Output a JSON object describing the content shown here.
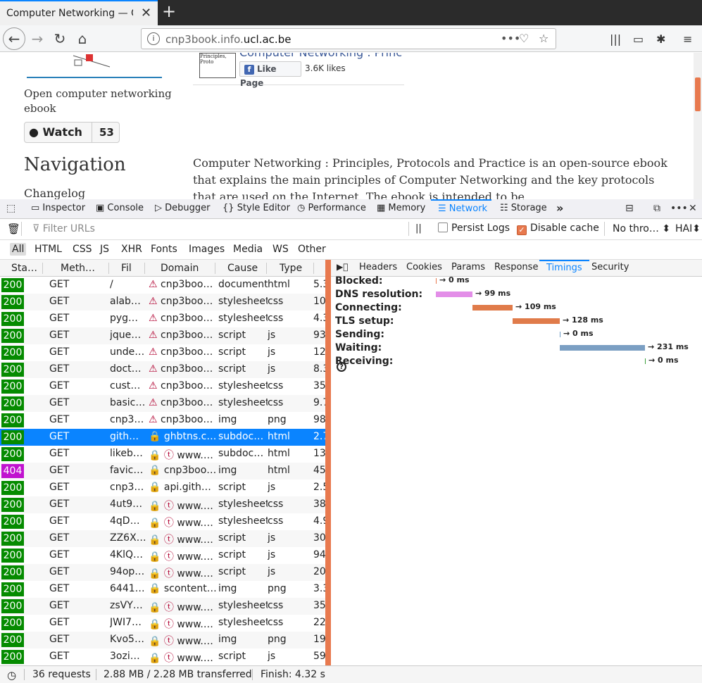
{
  "browser": {
    "tab_title": "Computer Networking — C",
    "tab_close": "✕",
    "new_tab": "+",
    "url_prefix": "cnp3book.info.",
    "url_domain": "ucl.ac.be",
    "url_info_icon": "i",
    "page_actions": "•••"
  },
  "page": {
    "tagline": "Open computer networking ebook",
    "watch_label": "Watch",
    "watch_count": "53",
    "nav_heading": "Navigation",
    "changelog": "Changelog",
    "fb_title": "Computer Networking : Princ",
    "fb_like": "Like Page",
    "fb_count": "3.6K likes",
    "fb_thumb_text": "Principles, Proto",
    "body_text": "Computer Networking : Principles, Protocols and Practice is an open-source ebook that explains the main principles of Computer Networking and the key protocols that are used on the Internet. The ebook is intended to be"
  },
  "devtools": {
    "tabs": [
      "Inspector",
      "Console",
      "Debugger",
      "Style Editor",
      "Performance",
      "Memory",
      "Network",
      "Storage"
    ],
    "active_tab": "Network",
    "more": "»",
    "close": "✕",
    "filter_placeholder": "Filter URLs",
    "pause": "||",
    "persist_logs": "Persist Logs",
    "disable_cache": "Disable cache",
    "throttling": "No thro… ⬍",
    "har": "HAI⬍",
    "types": [
      "All",
      "HTML",
      "CSS",
      "JS",
      "XHR",
      "Fonts",
      "Images",
      "Media",
      "WS",
      "Other"
    ],
    "columns": [
      "Sta…",
      "Meth…",
      "Fil",
      "Domain",
      "Cause",
      "Type"
    ],
    "rows": [
      {
        "status": "200",
        "method": "GET",
        "file": "/",
        "secure": false,
        "domain": "cnp3boo…",
        "cause": "document",
        "type": "html",
        "size": "5.3"
      },
      {
        "status": "200",
        "method": "GET",
        "file": "alab…",
        "secure": false,
        "domain": "cnp3boo…",
        "cause": "stylesheet",
        "type": "css",
        "size": "10"
      },
      {
        "status": "200",
        "method": "GET",
        "file": "pyg…",
        "secure": false,
        "domain": "cnp3boo…",
        "cause": "stylesheet",
        "type": "css",
        "size": "4.3"
      },
      {
        "status": "200",
        "method": "GET",
        "file": "jque…",
        "secure": false,
        "domain": "cnp3boo…",
        "cause": "script",
        "type": "js",
        "size": "93"
      },
      {
        "status": "200",
        "method": "GET",
        "file": "unde…",
        "secure": false,
        "domain": "cnp3boo…",
        "cause": "script",
        "type": "js",
        "size": "12"
      },
      {
        "status": "200",
        "method": "GET",
        "file": "doct…",
        "secure": false,
        "domain": "cnp3boo…",
        "cause": "script",
        "type": "js",
        "size": "8.3"
      },
      {
        "status": "200",
        "method": "GET",
        "file": "cust…",
        "secure": false,
        "domain": "cnp3boo…",
        "cause": "stylesheet",
        "type": "css",
        "size": "35"
      },
      {
        "status": "200",
        "method": "GET",
        "file": "basic…",
        "secure": false,
        "domain": "cnp3boo…",
        "cause": "stylesheet",
        "type": "css",
        "size": "9.7"
      },
      {
        "status": "200",
        "method": "GET",
        "file": "cnp3…",
        "secure": false,
        "domain": "cnp3boo…",
        "cause": "img",
        "type": "png",
        "size": "98"
      },
      {
        "status": "200",
        "method": "GET",
        "file": "gith…",
        "secure": true,
        "domain": "ghbtns.c…",
        "cause": "subdoc…",
        "type": "html",
        "size": "2.7"
      },
      {
        "status": "200",
        "method": "GET",
        "file": "likeb…",
        "secure": true,
        "tp": true,
        "domain": "www.…",
        "cause": "subdoc…",
        "type": "html",
        "size": "13"
      },
      {
        "status": "404",
        "method": "GET",
        "file": "favic…",
        "secure": true,
        "domain": "cnp3boo…",
        "cause": "img",
        "type": "html",
        "size": "45"
      },
      {
        "status": "200",
        "method": "GET",
        "file": "cnp3…",
        "secure": true,
        "domain": "api.gith…",
        "cause": "script",
        "type": "js",
        "size": "2.5"
      },
      {
        "status": "200",
        "method": "GET",
        "file": "4ut9…",
        "secure": true,
        "tp": true,
        "domain": "www.…",
        "cause": "stylesheet",
        "type": "css",
        "size": "38"
      },
      {
        "status": "200",
        "method": "GET",
        "file": "4qD…",
        "secure": true,
        "tp": true,
        "domain": "www.…",
        "cause": "stylesheet",
        "type": "css",
        "size": "4.9"
      },
      {
        "status": "200",
        "method": "GET",
        "file": "ZZ6X…",
        "secure": true,
        "tp": true,
        "domain": "www.…",
        "cause": "script",
        "type": "js",
        "size": "30"
      },
      {
        "status": "200",
        "method": "GET",
        "file": "4KlQ…",
        "secure": true,
        "tp": true,
        "domain": "www.…",
        "cause": "script",
        "type": "js",
        "size": "94"
      },
      {
        "status": "200",
        "method": "GET",
        "file": "94op…",
        "secure": true,
        "tp": true,
        "domain": "www.…",
        "cause": "script",
        "type": "js",
        "size": "20"
      },
      {
        "status": "200",
        "method": "GET",
        "file": "6441…",
        "secure": true,
        "domain": "scontent…",
        "cause": "img",
        "type": "png",
        "size": "3.3"
      },
      {
        "status": "200",
        "method": "GET",
        "file": "zsVY…",
        "secure": true,
        "tp": true,
        "domain": "www.…",
        "cause": "stylesheet",
        "type": "css",
        "size": "35"
      },
      {
        "status": "200",
        "method": "GET",
        "file": "JWI7…",
        "secure": true,
        "tp": true,
        "domain": "www.…",
        "cause": "stylesheet",
        "type": "css",
        "size": "22"
      },
      {
        "status": "200",
        "method": "GET",
        "file": "Kvo5…",
        "secure": true,
        "tp": true,
        "domain": "www.…",
        "cause": "img",
        "type": "png",
        "size": "19"
      },
      {
        "status": "200",
        "method": "GET",
        "file": "3ozi…",
        "secure": true,
        "tp": true,
        "domain": "www.…",
        "cause": "script",
        "type": "js",
        "size": "59"
      }
    ],
    "selected_row": 9,
    "side_tabs": [
      "Headers",
      "Cookies",
      "Params",
      "Response",
      "Timings",
      "Security"
    ],
    "active_side_tab": "Timings",
    "timings": [
      {
        "label": "Blocked:",
        "ms": 0,
        "value": "→ 0 ms",
        "color": "#e8794e"
      },
      {
        "label": "DNS resolution:",
        "ms": 99,
        "value": "→ 99 ms",
        "color": "#e38ee8"
      },
      {
        "label": "Connecting:",
        "ms": 109,
        "value": "→ 109 ms",
        "color": "#e07b4a"
      },
      {
        "label": "TLS setup:",
        "ms": 128,
        "value": "→ 128 ms",
        "color": "#e07b4a"
      },
      {
        "label": "Sending:",
        "ms": 0,
        "value": "→ 0 ms",
        "color": "#6e9bc5"
      },
      {
        "label": "Waiting:",
        "ms": 231,
        "value": "→ 231 ms",
        "color": "#7b9fc3"
      },
      {
        "label": "Receiving:",
        "ms": 0,
        "value": "→ 0 ms",
        "color": "#3aa03a"
      }
    ],
    "help_icon": "?",
    "status": {
      "requests": "36 requests",
      "transferred": "2.88 MB / 2.28 MB transferred",
      "finish": "Finish: 4.32 s"
    }
  }
}
